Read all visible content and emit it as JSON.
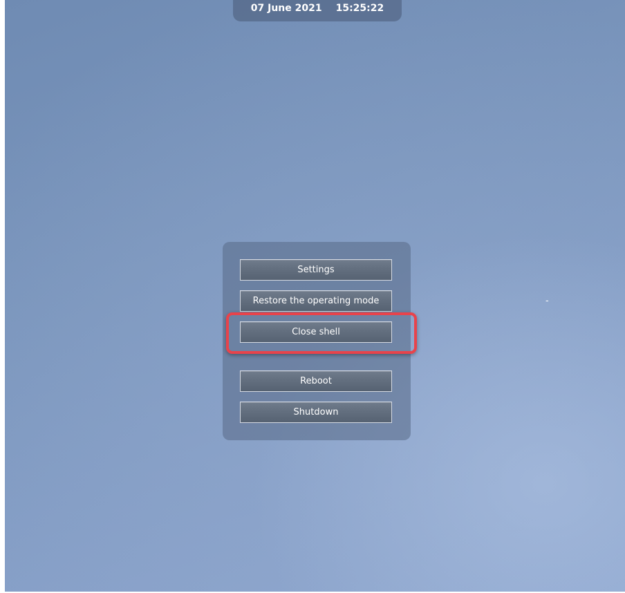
{
  "header": {
    "date": "07 June 2021",
    "time": "15:25:22"
  },
  "menu": {
    "settings_label": "Settings",
    "restore_label": "Restore the operating mode",
    "close_shell_label": "Close shell",
    "reboot_label": "Reboot",
    "shutdown_label": "Shutdown"
  },
  "stray_mark": "-",
  "colors": {
    "highlight_border": "#e8434b",
    "button_face": "#636f7f",
    "desktop_background": "#7b96bd"
  }
}
